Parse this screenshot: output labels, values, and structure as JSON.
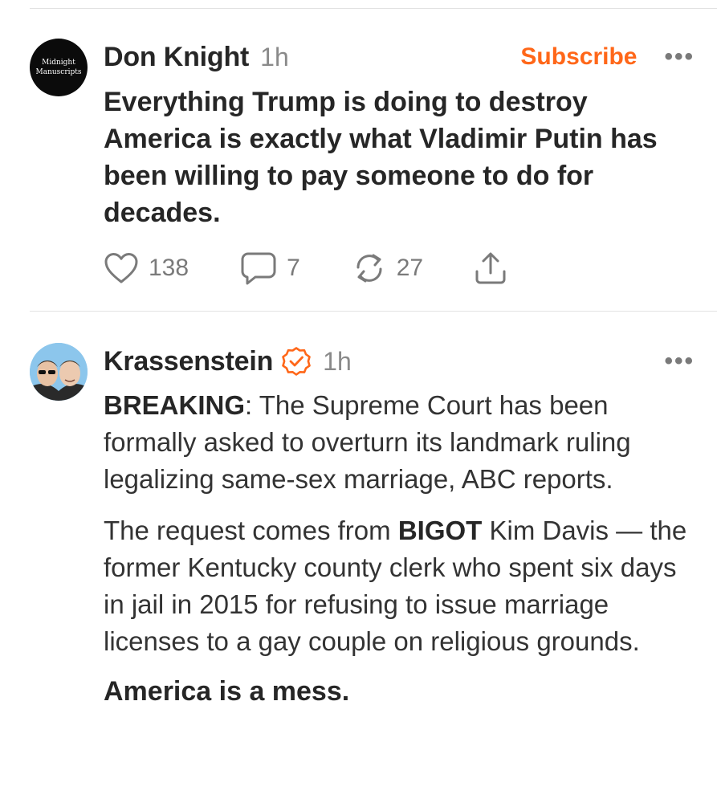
{
  "posts": [
    {
      "avatar_text_line1": "Midnight",
      "avatar_text_line2": "Manuscripts",
      "author": "Don Knight",
      "time": "1h",
      "subscribe_label": "Subscribe",
      "more_label": "•••",
      "body": "Everything Trump is doing to destroy America is exactly what Vladimir Putin has been willing to pay someone to do for decades.",
      "likes": "138",
      "comments": "7",
      "restacks": "27"
    },
    {
      "author": "Krassenstein",
      "time": "1h",
      "more_label": "•••",
      "p1_bold": "BREAKING",
      "p1_rest": ": The Supreme Court has been formally asked to overturn its landmark ruling legalizing same-sex marriage, ABC reports.",
      "p2_start": "The request comes from ",
      "p2_bold": "BIGOT",
      "p2_rest": " Kim Davis — the former Kentucky county clerk who spent six days in jail in 2015 for refusing to issue marriage licenses to a gay couple on religious grounds.",
      "p3": "America is a mess."
    }
  ],
  "colors": {
    "accent": "#ff6719",
    "muted": "#8a8a8a",
    "text": "#262626"
  },
  "icons": {
    "like": "heart-icon",
    "comment": "speech-bubble-icon",
    "restack": "restack-arrows-icon",
    "share": "share-icon",
    "verified": "verified-badge-icon"
  }
}
